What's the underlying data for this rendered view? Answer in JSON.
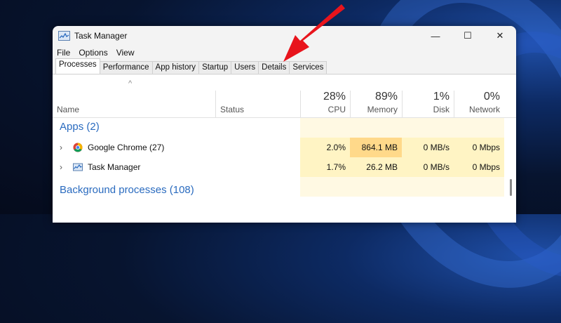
{
  "window": {
    "title": "Task Manager"
  },
  "menu": [
    "File",
    "Options",
    "View"
  ],
  "tabs": [
    "Processes",
    "Performance",
    "App history",
    "Startup",
    "Users",
    "Details",
    "Services"
  ],
  "columns": {
    "name": "Name",
    "status": "Status",
    "cpu": {
      "pct": "28%",
      "label": "CPU"
    },
    "memory": {
      "pct": "89%",
      "label": "Memory"
    },
    "disk": {
      "pct": "1%",
      "label": "Disk"
    },
    "network": {
      "pct": "0%",
      "label": "Network"
    }
  },
  "sections": {
    "apps": "Apps (2)",
    "background": "Background processes (108)"
  },
  "processes": [
    {
      "name": "Google Chrome (27)",
      "cpu": "2.0%",
      "memory": "864.1 MB",
      "disk": "0 MB/s",
      "network": "0 Mbps"
    },
    {
      "name": "Task Manager",
      "cpu": "1.7%",
      "memory": "26.2 MB",
      "disk": "0 MB/s",
      "network": "0 Mbps"
    }
  ],
  "colors": {
    "accent": "#2a6bbf",
    "cpu_heat": "#fff4c4",
    "mem_heat": "#ffd98a",
    "heat_light": "#fff9e3",
    "arrow": "#e8141c"
  },
  "icons": {
    "app": "task-manager-icon",
    "chrome": "chrome-icon",
    "pointer": "red-arrow-annotation"
  },
  "window_controls": {
    "minimize": "—",
    "maximize": "☐",
    "close": "✕"
  },
  "expander_glyph": "›",
  "sort_glyph": "^"
}
